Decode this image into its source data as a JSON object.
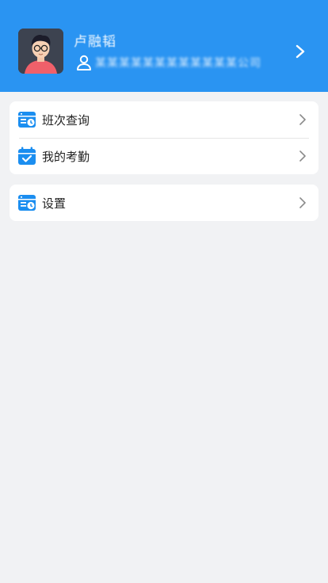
{
  "profile": {
    "name": "卢融韬",
    "company": "某某某某某某某某某某某某公司",
    "avatar_icon": "cartoon-avatar-icon"
  },
  "menu_group_1": [
    {
      "label": "班次查询",
      "icon": "schedule-icon"
    },
    {
      "label": "我的考勤",
      "icon": "calendar-check-icon"
    }
  ],
  "menu_group_2": [
    {
      "label": "设置",
      "icon": "settings-schedule-icon"
    }
  ],
  "colors": {
    "header_bg": "#2a94f2",
    "icon_blue": "#1b8ef0",
    "page_bg": "#f1f2f4"
  }
}
